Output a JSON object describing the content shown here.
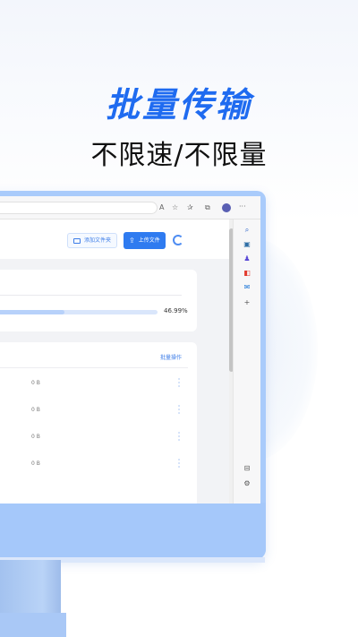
{
  "promo": {
    "headline": "批量传输",
    "subheadline": "不限速/不限量"
  },
  "browser": {
    "toolbar_icons": [
      "read-aloud-icon",
      "favorite-icon",
      "favorites-icon",
      "collections-icon",
      "profile-avatar",
      "more-icon"
    ],
    "read_aloud_label": "A",
    "more_label": "···",
    "sidebar_icons": [
      "search-icon",
      "tools-icon",
      "games-icon",
      "office-icon",
      "outlook-icon",
      "add-icon",
      "sidebar-toggle-icon",
      "settings-icon"
    ]
  },
  "page": {
    "add_folder_label": "添加文件夹",
    "upload_label": "上传文件",
    "progress": {
      "percent_text": "46.99%",
      "value": 0.4699
    },
    "list": {
      "batch_action_label": "批量操作",
      "rows": [
        {
          "size": "0 B"
        },
        {
          "size": "0 B"
        },
        {
          "size": "0 B"
        },
        {
          "size": "0 B"
        }
      ]
    }
  },
  "colors": {
    "brand_blue": "#1f6bf0",
    "monitor_blue": "#a9cbfb",
    "button_blue": "#2f7bf0"
  }
}
